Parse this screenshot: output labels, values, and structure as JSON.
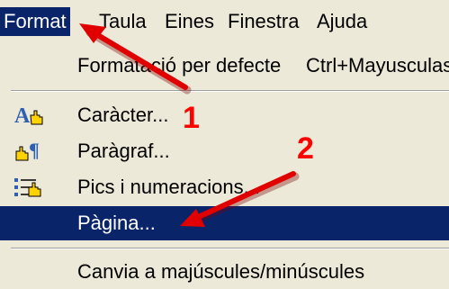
{
  "menubar": {
    "items": [
      {
        "label": "Format",
        "active": true
      },
      {
        "label": "Taula"
      },
      {
        "label": "Eines"
      },
      {
        "label": "Finestra"
      },
      {
        "label": "Ajuda"
      }
    ]
  },
  "menu": {
    "items": [
      {
        "label": "Formatació per defecte",
        "shortcut": "Ctrl+Mayusculas"
      },
      {
        "label": "Caràcter...",
        "icon": "character-format-icon"
      },
      {
        "label": "Paràgraf...",
        "icon": "paragraph-format-icon"
      },
      {
        "label": "Pics i numeracions...",
        "icon": "bullets-numbering-icon"
      },
      {
        "label": "Pàgina...",
        "highlighted": true
      },
      {
        "label": "Canvia a majúscules/minúscules"
      }
    ]
  },
  "annotations": {
    "step1": "1",
    "step2": "2"
  },
  "colors": {
    "menu_bg": "#ece9d8",
    "highlight_bg": "#0a246a",
    "annotation": "#ff0000"
  }
}
